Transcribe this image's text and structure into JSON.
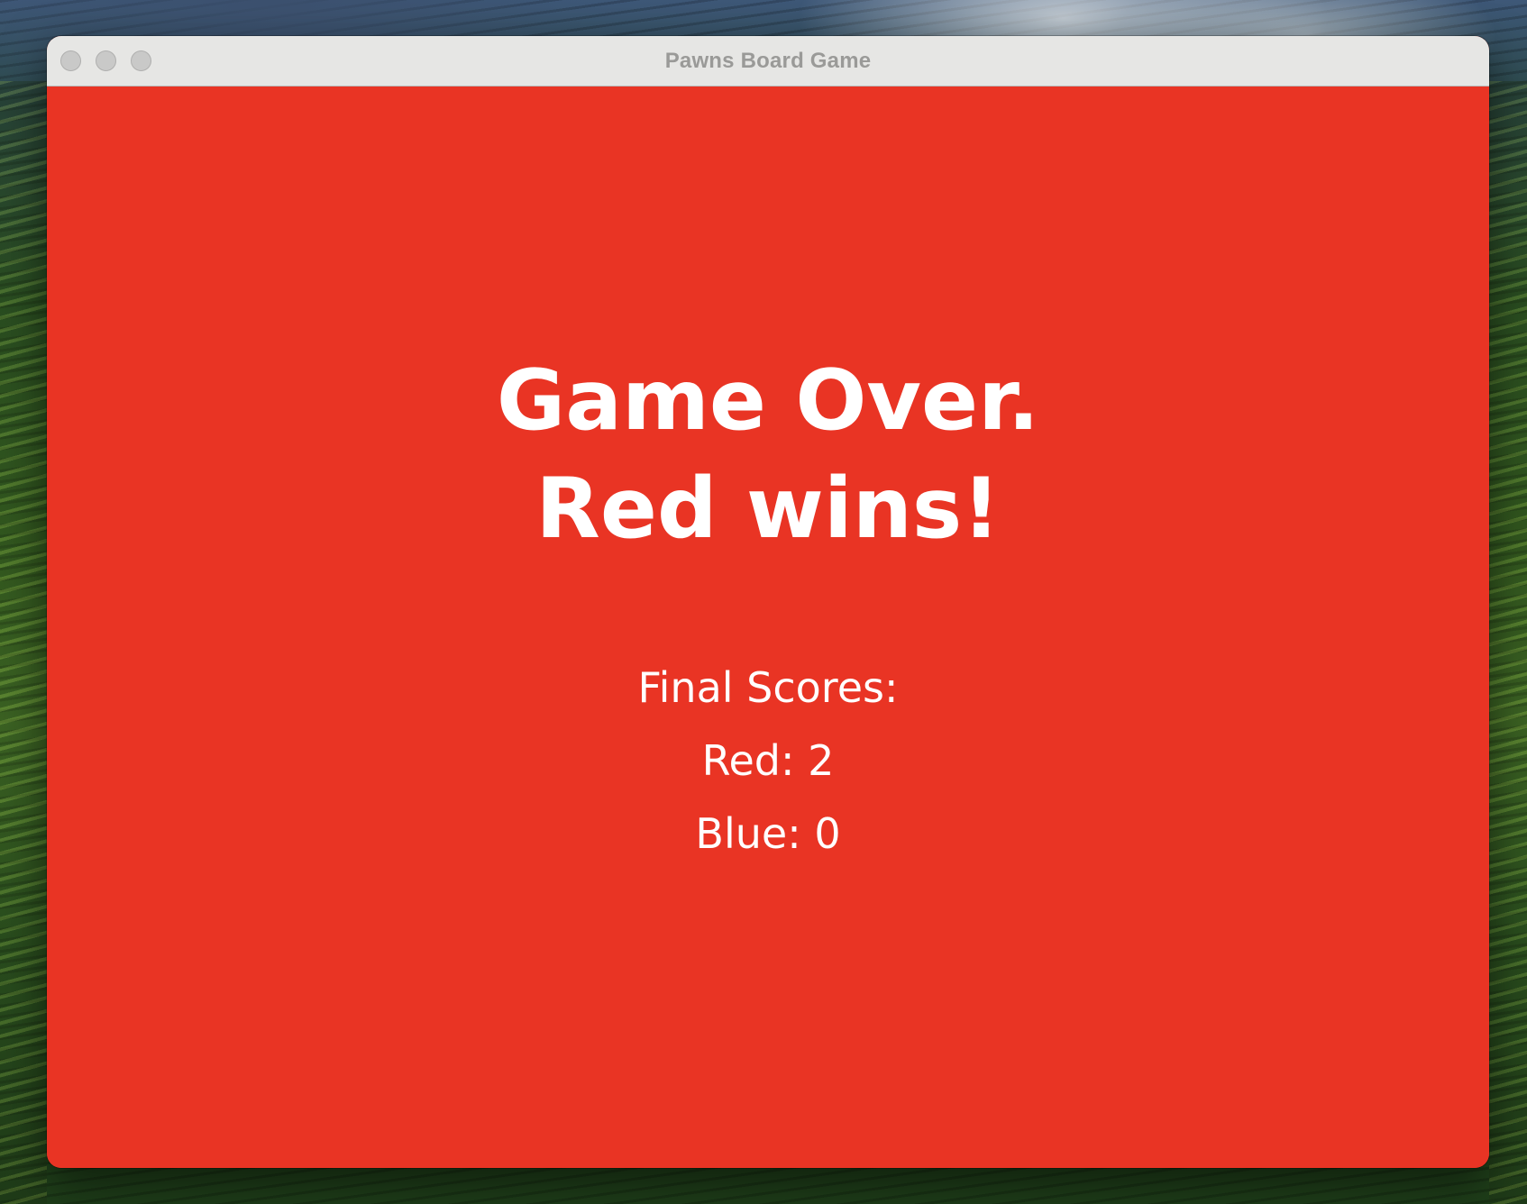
{
  "window": {
    "title": "Pawns Board Game"
  },
  "game_over": {
    "line1": "Game Over.",
    "line2": "Red wins!",
    "scores_heading": "Final Scores:",
    "scores": [
      {
        "player": "Red",
        "label": "Red: 2",
        "value": 2
      },
      {
        "player": "Blue",
        "label": "Blue: 0",
        "value": 0
      }
    ]
  },
  "colors": {
    "background": "#e93424",
    "text": "#ffffff",
    "titlebar": "#e6e6e4",
    "title_text": "#9a9a98"
  }
}
